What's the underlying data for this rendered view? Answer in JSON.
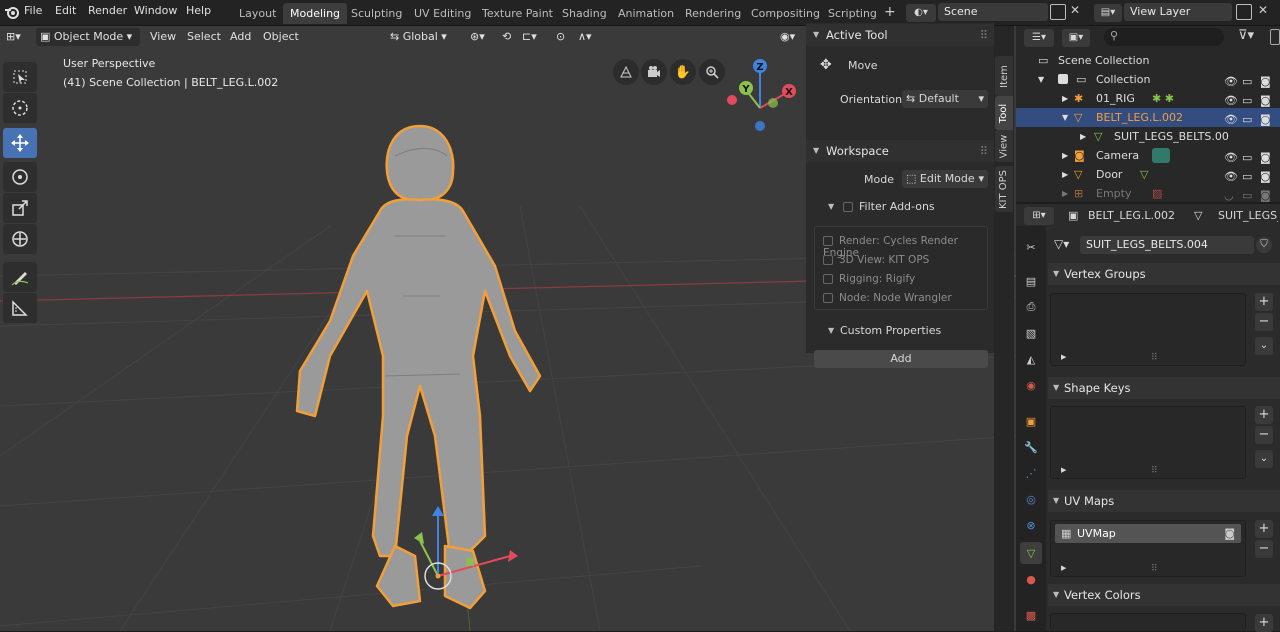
{
  "colors": {
    "accent": "#4772b3",
    "selection": "#334d80",
    "object_orange": "#f29f3a",
    "axis_x": "#e24b5b",
    "axis_y": "#8bc34a",
    "axis_z": "#3f84e5"
  },
  "menu": [
    "File",
    "Edit",
    "Render",
    "Window",
    "Help"
  ],
  "workspaces": [
    "Layout",
    "Modeling",
    "Sculpting",
    "UV Editing",
    "Texture Paint",
    "Shading",
    "Animation",
    "Rendering",
    "Compositing",
    "Scripting"
  ],
  "active_workspace": "Modeling",
  "scene": {
    "name": "Scene"
  },
  "view_layer": {
    "name": "View Layer"
  },
  "viewport_header": {
    "mode": "Object Mode",
    "menus": [
      "View",
      "Select",
      "Add",
      "Object"
    ],
    "orientation": "Global"
  },
  "overlay": {
    "line1": "User Perspective",
    "line2": "(41) Scene Collection | BELT_LEG.L.002"
  },
  "gizmo": {
    "x": "X",
    "y": "Y",
    "z": "Z"
  },
  "tools": [
    "select-box-icon",
    "cursor-icon",
    "move-icon",
    "rotate-icon",
    "scale-icon",
    "transform-icon",
    "annotate-icon",
    "measure-icon"
  ],
  "npanel": {
    "active_tool": {
      "title": "Active Tool",
      "tool": "Move",
      "orientation_label": "Orientation",
      "orientation_value": "Default"
    },
    "workspace": {
      "title": "Workspace",
      "mode_label": "Mode",
      "mode_value": "Edit Mode",
      "filter_label": "Filter Add-ons",
      "addons": [
        "Render: Cycles Render Engine",
        "3D View: KIT OPS",
        "Rigging: Rigify",
        "Node: Node Wrangler"
      ]
    },
    "custom_properties": {
      "title": "Custom Properties",
      "add_label": "Add"
    }
  },
  "side_tabs": [
    "Item",
    "Tool",
    "View",
    "KIT OPS"
  ],
  "outliner": {
    "search_placeholder": "",
    "rows": [
      "Scene Collection",
      "Collection",
      "01_RIG",
      "BELT_LEG.L.002",
      "SUIT_LEGS_BELTS.00",
      "Camera",
      "Door",
      "Empty"
    ]
  },
  "properties": {
    "breadcrumb_object": "BELT_LEG.L.002",
    "breadcrumb_mesh": "SUIT_LEGS_BE",
    "mesh_name": "SUIT_LEGS_BELTS.004",
    "sections": {
      "vertex_groups": "Vertex Groups",
      "shape_keys": "Shape Keys",
      "uv_maps": "UV Maps",
      "vertex_colors": "Vertex Colors"
    },
    "uv_map_item": "UVMap"
  }
}
